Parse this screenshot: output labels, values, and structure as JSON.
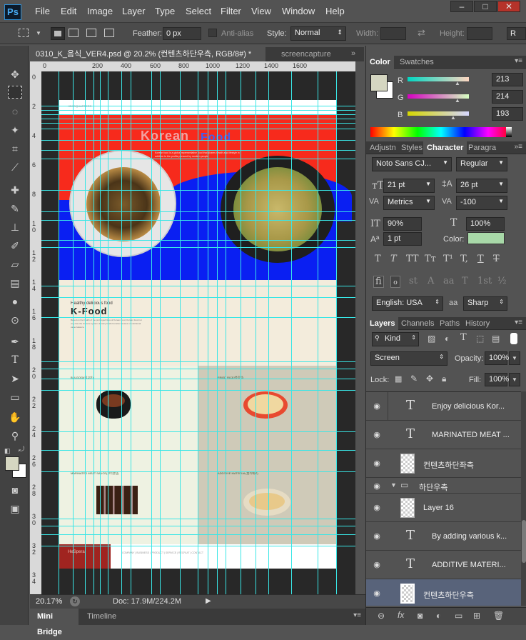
{
  "app": {
    "logo": "Ps"
  },
  "menu": [
    "File",
    "Edit",
    "Image",
    "Layer",
    "Type",
    "Select",
    "Filter",
    "View",
    "Window",
    "Help"
  ],
  "window_controls": [
    "–",
    "□",
    "✕"
  ],
  "options": {
    "feather_label": "Feather:",
    "feather_value": "0 px",
    "antialias_label": "Anti-alias",
    "style_label": "Style:",
    "style_value": "Normal",
    "width_label": "Width:",
    "height_label": "Height:",
    "refine_label": "R"
  },
  "doc_tabs": [
    {
      "label": "0310_K_음식_VER4.psd @ 20.2% (컨텐츠하단우측, RGB/8#) *"
    },
    {
      "label": "screencapture"
    }
  ],
  "ruler_h": [
    "0",
    "200",
    "400",
    "600",
    "800",
    "1000",
    "1200",
    "1400",
    "1600"
  ],
  "ruler_v": [
    "0",
    "2",
    "4",
    "6",
    "8",
    "1\n0",
    "1\n2",
    "1\n4",
    "1\n6",
    "1\n8",
    "2\n0",
    "2\n2",
    "2\n4",
    "2\n6",
    "2\n8",
    "3\n0",
    "3\n2",
    "3\n4"
  ],
  "artboard": {
    "header_small_left": "HEADQUARTERS",
    "title_a": "Korean",
    "title_b": "Food",
    "intro": "Korean food is a global representative food that shares health and lifestyle in addition to the profits pursued by modern people.",
    "section_sub": "Healthy delicious food",
    "section_title": "K-Food",
    "section_body": "Based on the health of the prolonged lives of Korean food, Korean food not only has the immune system of many foods but also focuses on nutritional value balance.",
    "q1_label": "BULGOGI(불고기)",
    "q2_label": "FRIED RICE(볶음밥)",
    "q3_label": "MARINATED MEAT SAUCE(고기양념)",
    "q4_label": "ADDITIVE MATERIAL(첨가재료)",
    "footer_logo": "HeSpera",
    "footer_links": "COMPANY | BUSINESS | PRODUCT | SERVICE | RECRUIT | CONTACT"
  },
  "status": {
    "zoom": "20.17%",
    "doc": "Doc: 17.9M/224.2M"
  },
  "bottom_tabs": [
    "Mini Bridge",
    "Timeline"
  ],
  "color_panel": {
    "tabs": [
      "Color",
      "Swatches"
    ],
    "r_label": "R",
    "r_value": "213",
    "g_label": "G",
    "g_value": "214",
    "b_label": "B",
    "b_value": "193",
    "swatch_color": "#d5d6c1"
  },
  "character_panel": {
    "tabs": [
      "Adjustn",
      "Styles",
      "Character",
      "Paragra"
    ],
    "font_family": "Noto Sans CJ...",
    "font_style": "Regular",
    "font_size": "21 pt",
    "leading": "26 pt",
    "kerning": "Metrics",
    "tracking": "-100",
    "vscale": "90%",
    "hscale": "100%",
    "baseline": "1 pt",
    "color_label": "Color:",
    "text_color": "#a8d8a8",
    "style_glyphs": [
      "T",
      "T",
      "TT",
      "Tт",
      "T¹",
      "T,",
      "T",
      "T"
    ],
    "ot_glyphs": [
      "fi",
      "ℴ",
      "st",
      "A",
      "aa",
      "T",
      "1st",
      "½"
    ],
    "language": "English: USA",
    "aa_label": "aa",
    "antialias": "Sharp"
  },
  "layers_panel": {
    "tabs": [
      "Layers",
      "Channels",
      "Paths",
      "History"
    ],
    "filter_kind": "Kind",
    "blend_mode": "Screen",
    "opacity_label": "Opacity:",
    "opacity": "100%",
    "lock_label": "Lock:",
    "fill_label": "Fill:",
    "fill": "100%",
    "layers": [
      {
        "type": "text",
        "name": "Enjoy delicious Kor...",
        "selected": false,
        "group": false
      },
      {
        "type": "text",
        "name": "MARINATED MEAT ...",
        "selected": false,
        "group": false
      },
      {
        "type": "pixel",
        "name": "컨텐츠하단좌측",
        "selected": false,
        "group": false
      },
      {
        "type": "group",
        "name": "하단우측",
        "selected": false,
        "group": true
      },
      {
        "type": "pixel",
        "name": "Layer 16",
        "selected": false,
        "group": false
      },
      {
        "type": "text",
        "name": "By adding various k...",
        "selected": false,
        "group": false
      },
      {
        "type": "text",
        "name": "ADDITIVE MATERI...",
        "selected": false,
        "group": false
      },
      {
        "type": "pixel",
        "name": "컨텐츠하단우측",
        "selected": true,
        "group": false
      }
    ],
    "footer_icons": [
      "link-icon",
      "fx-icon",
      "mask-icon",
      "adjustment-icon",
      "folder-icon",
      "new-layer-icon",
      "trash-icon"
    ]
  }
}
